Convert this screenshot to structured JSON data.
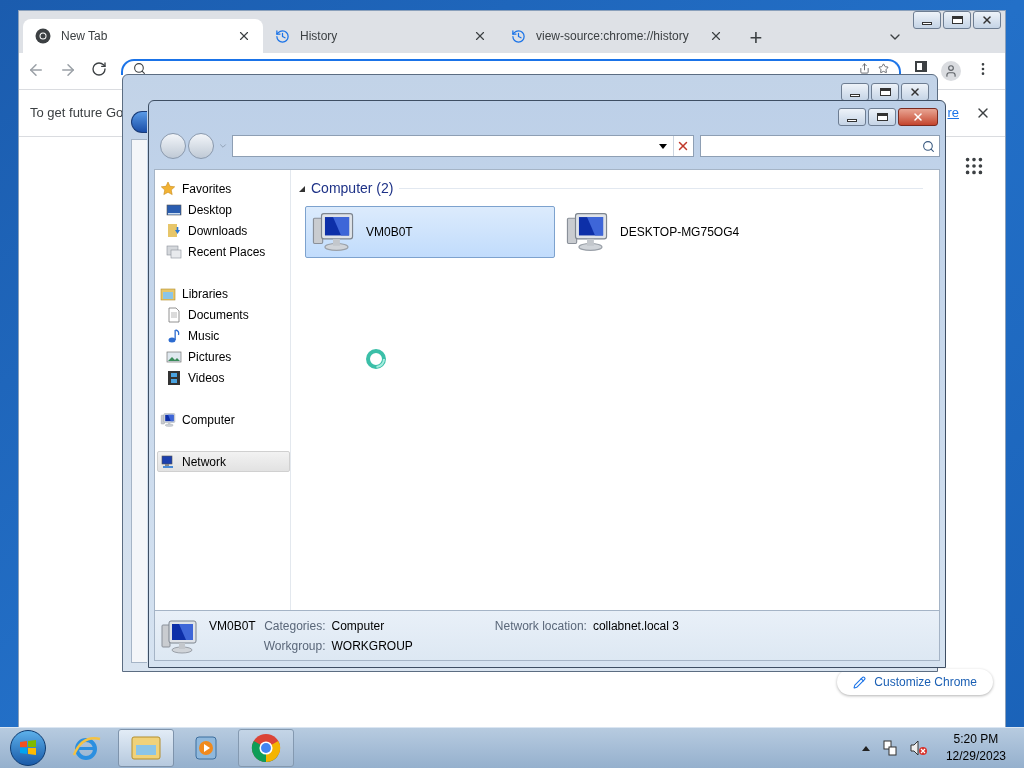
{
  "browser": {
    "tabs": [
      {
        "title": "New Tab",
        "kind": "chrome",
        "selected": true
      },
      {
        "title": "History",
        "kind": "history",
        "selected": false
      },
      {
        "title": "view-source:chrome://history",
        "kind": "history",
        "selected": false
      }
    ],
    "new_tab": "+",
    "infobar": {
      "text": "To get future Go",
      "link": "re"
    },
    "customize_button": "Customize Chrome"
  },
  "explorer": {
    "nav": [
      {
        "label": "Favorites",
        "selected": false,
        "children": [
          {
            "label": "Desktop",
            "selected": false
          },
          {
            "label": "Downloads",
            "selected": false
          },
          {
            "label": "Recent Places",
            "selected": false
          }
        ]
      },
      {
        "label": "Libraries",
        "selected": false,
        "children": [
          {
            "label": "Documents",
            "selected": false
          },
          {
            "label": "Music",
            "selected": false
          },
          {
            "label": "Pictures",
            "selected": false
          },
          {
            "label": "Videos",
            "selected": false
          }
        ]
      },
      {
        "label": "Computer",
        "selected": false
      },
      {
        "label": "Network",
        "selected": true
      }
    ],
    "group": {
      "title": "Computer (2)",
      "expanded": true
    },
    "items": [
      {
        "name": "VM0B0T",
        "selected": true
      },
      {
        "name": "DESKTOP-MG75OG4",
        "selected": false
      }
    ],
    "details": {
      "name": "VM0B0T",
      "fields": [
        {
          "label": "Categories:",
          "value": "Computer"
        },
        {
          "label": "Workgroup:",
          "value": "WORKGROUP"
        },
        {
          "label": "Network location:",
          "value": "collabnet.local 3"
        }
      ]
    }
  },
  "taskbar": {
    "buttons": [
      {
        "kind": "ie",
        "selected": false
      },
      {
        "kind": "explorer",
        "selected": true
      },
      {
        "kind": "media",
        "selected": false
      },
      {
        "kind": "chrome",
        "selected": false
      }
    ],
    "time": "5:20 PM",
    "date": "12/29/2023"
  }
}
